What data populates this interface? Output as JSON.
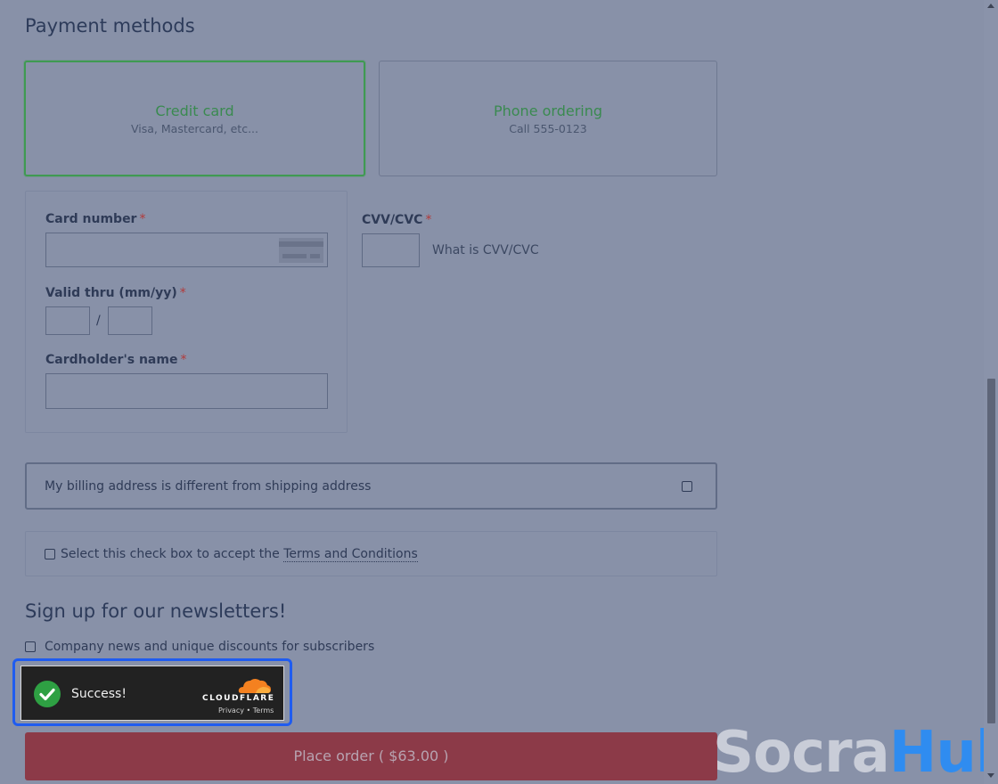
{
  "payment": {
    "title": "Payment methods",
    "methods": [
      {
        "title": "Credit card",
        "subtitle": "Visa, Mastercard, etc..."
      },
      {
        "title": "Phone ordering",
        "subtitle": "Call 555-0123"
      }
    ]
  },
  "card_form": {
    "card_number_label": "Card number",
    "cvv_label": "CVV/CVC",
    "cvv_help": "What is CVV/CVC",
    "valid_thru_label": "Valid thru (mm/yy)",
    "date_separator": "/",
    "cardholder_label": "Cardholder's name",
    "required_mark": "*"
  },
  "billing": {
    "label": "My billing address is different from shipping address"
  },
  "terms": {
    "prefix": "Select this check box to accept the ",
    "link": "Terms and Conditions"
  },
  "newsletter": {
    "title": "Sign up for our newsletters!",
    "option": "Company news and unique discounts for subscribers"
  },
  "captcha": {
    "status": "Success!",
    "brand": "CLOUDFLARE",
    "privacy": "Privacy",
    "separator": "•",
    "terms": "Terms"
  },
  "order": {
    "button": "Place order ( $63.00 )"
  },
  "watermark": {
    "part1": "Socra",
    "part2": "Hub"
  }
}
